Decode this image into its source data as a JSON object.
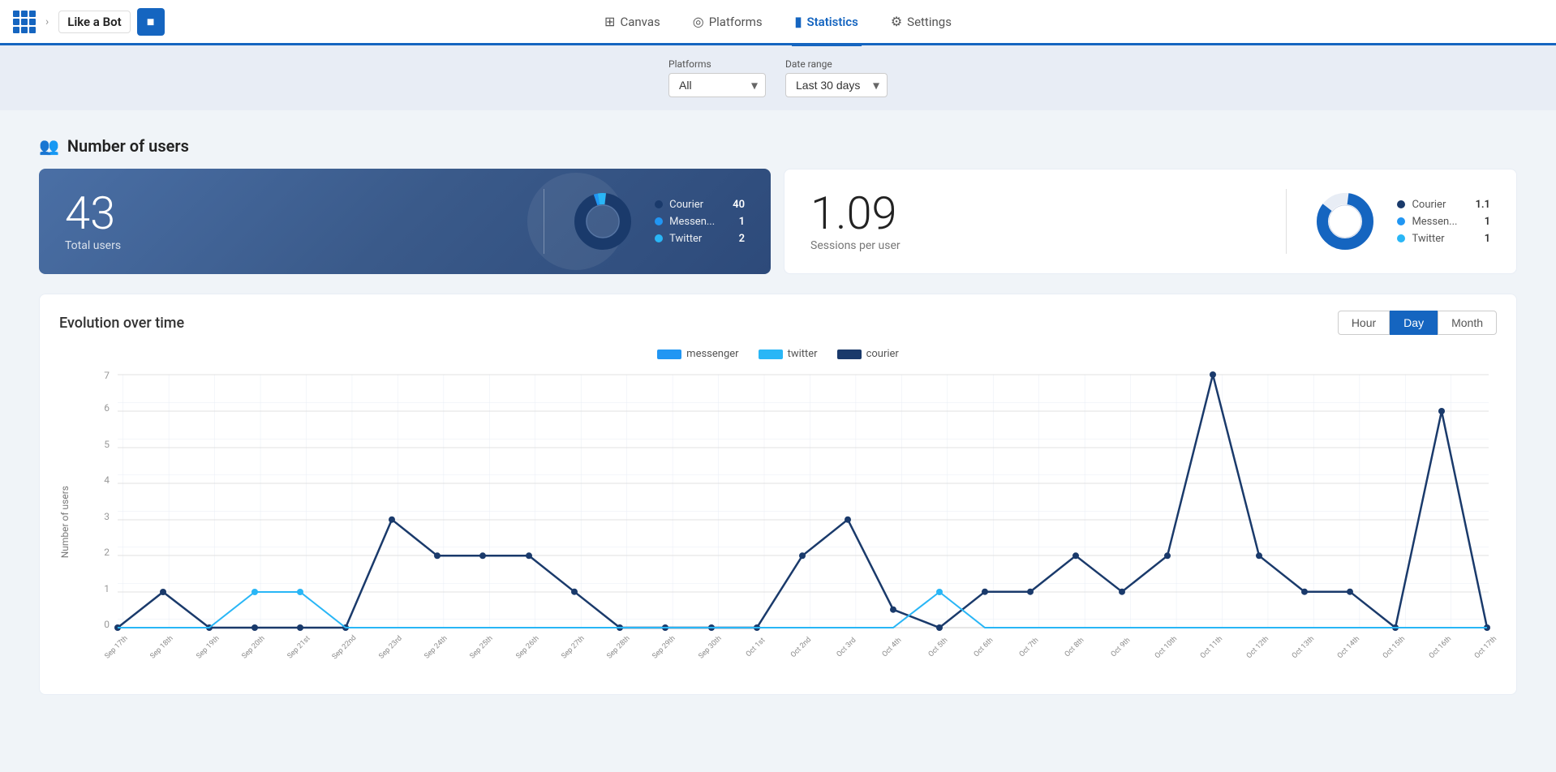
{
  "nav": {
    "bot_name": "Like a Bot",
    "items": [
      {
        "id": "canvas",
        "label": "Canvas",
        "icon": "⊞",
        "active": false
      },
      {
        "id": "platforms",
        "label": "Platforms",
        "icon": "◎",
        "active": false
      },
      {
        "id": "statistics",
        "label": "Statistics",
        "icon": "📊",
        "active": true
      },
      {
        "id": "settings",
        "label": "Settings",
        "icon": "⚙",
        "active": false
      }
    ]
  },
  "filters": {
    "platforms_label": "Platforms",
    "platforms_value": "All",
    "date_range_label": "Date range",
    "date_range_value": "Last 30 days"
  },
  "section": {
    "title": "Number of users"
  },
  "users_card": {
    "total": "43",
    "label": "Total users",
    "legend": [
      {
        "name": "Courier",
        "value": "40",
        "color": "#1a3a6b"
      },
      {
        "name": "Messen...",
        "value": "1",
        "color": "#2196f3"
      },
      {
        "name": "Twitter",
        "value": "2",
        "color": "#29b6f6"
      }
    ]
  },
  "sessions_card": {
    "value": "1.09",
    "label": "Sessions per user",
    "legend": [
      {
        "name": "Courier",
        "value": "1.1",
        "color": "#1a3a6b"
      },
      {
        "name": "Messen...",
        "value": "1",
        "color": "#2196f3"
      },
      {
        "name": "Twitter",
        "value": "1",
        "color": "#29b6f6"
      }
    ]
  },
  "chart": {
    "title": "Evolution over time",
    "time_buttons": [
      "Hour",
      "Day",
      "Month"
    ],
    "active_time": "Day",
    "y_axis_label": "Number of users",
    "legend": [
      {
        "label": "messenger",
        "color": "#2196f3"
      },
      {
        "label": "twitter",
        "color": "#29b6f6"
      },
      {
        "label": "courier",
        "color": "#1a3a6b"
      }
    ],
    "x_labels": [
      "Sep 17th",
      "Sep 18th",
      "Sep 19th",
      "Sep 20th",
      "Sep 21st",
      "Sep 22nd",
      "Sep 23rd",
      "Sep 24th",
      "Sep 25th",
      "Sep 26th",
      "Sep 27th",
      "Sep 28th",
      "Sep 29th",
      "Sep 30th",
      "Oct 1st",
      "Oct 2nd",
      "Oct 3rd",
      "Oct 4th",
      "Oct 5th",
      "Oct 6th",
      "Oct 7th",
      "Oct 8th",
      "Oct 9th",
      "Oct 10th",
      "Oct 11th",
      "Oct 12th",
      "Oct 13th",
      "Oct 14th",
      "Oct 15th",
      "Oct 16th",
      "Oct 17th"
    ],
    "y_max": 7,
    "courier_data": [
      0,
      1,
      0,
      0,
      0,
      0,
      3,
      2,
      2,
      2,
      1,
      0,
      0,
      0,
      0,
      2,
      3,
      0.5,
      0,
      1,
      1,
      2,
      1,
      2,
      7,
      2,
      1,
      1,
      0,
      6,
      0
    ],
    "messenger_data": [
      0,
      0,
      0,
      0,
      0,
      0,
      0,
      0,
      0,
      0,
      0,
      0,
      0,
      0,
      0,
      0,
      0,
      0,
      0,
      0,
      0,
      0,
      0,
      0,
      0,
      0,
      0,
      0,
      0,
      0,
      0
    ],
    "twitter_data": [
      0,
      0,
      0,
      1,
      1,
      0,
      0,
      0,
      0,
      0,
      0,
      0,
      0,
      0,
      0,
      0,
      0,
      0,
      1,
      0,
      0,
      0,
      0,
      0,
      0,
      0,
      0,
      0,
      0,
      0,
      0
    ]
  }
}
